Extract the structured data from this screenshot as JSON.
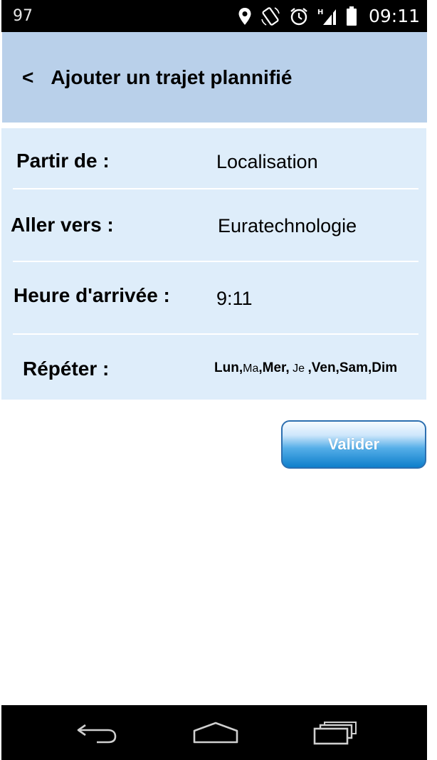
{
  "status_bar": {
    "battery_level": "97",
    "time": "09:11",
    "icons": [
      "location-icon",
      "screen-rotation-icon",
      "alarm-icon",
      "signal-icon",
      "battery-icon"
    ]
  },
  "header": {
    "back_label": "<",
    "title": "Ajouter un trajet plannifié",
    "background_color": "#b9d0ea"
  },
  "form": {
    "background_color": "#deedfa",
    "rows": [
      {
        "label": "Partir de :",
        "value": "Localisation"
      },
      {
        "label": "Aller vers :",
        "value": "Euratechnologie"
      },
      {
        "label": "Heure d'arrivée :",
        "value": "9:11"
      },
      {
        "label": "Répéter :",
        "days": {
          "lun": "Lun,",
          "ma": "Ma",
          "mer": ",Mer,",
          "je": "Je",
          "ven": ",Ven,",
          "sam": "Sam,",
          "dim": "Dim"
        }
      }
    ]
  },
  "actions": {
    "validate_label": "Valider",
    "validate_color": "#0e7fcb"
  },
  "nav_bar": {
    "icons": [
      "back-arrow-icon",
      "home-icon",
      "recent-apps-icon"
    ]
  }
}
